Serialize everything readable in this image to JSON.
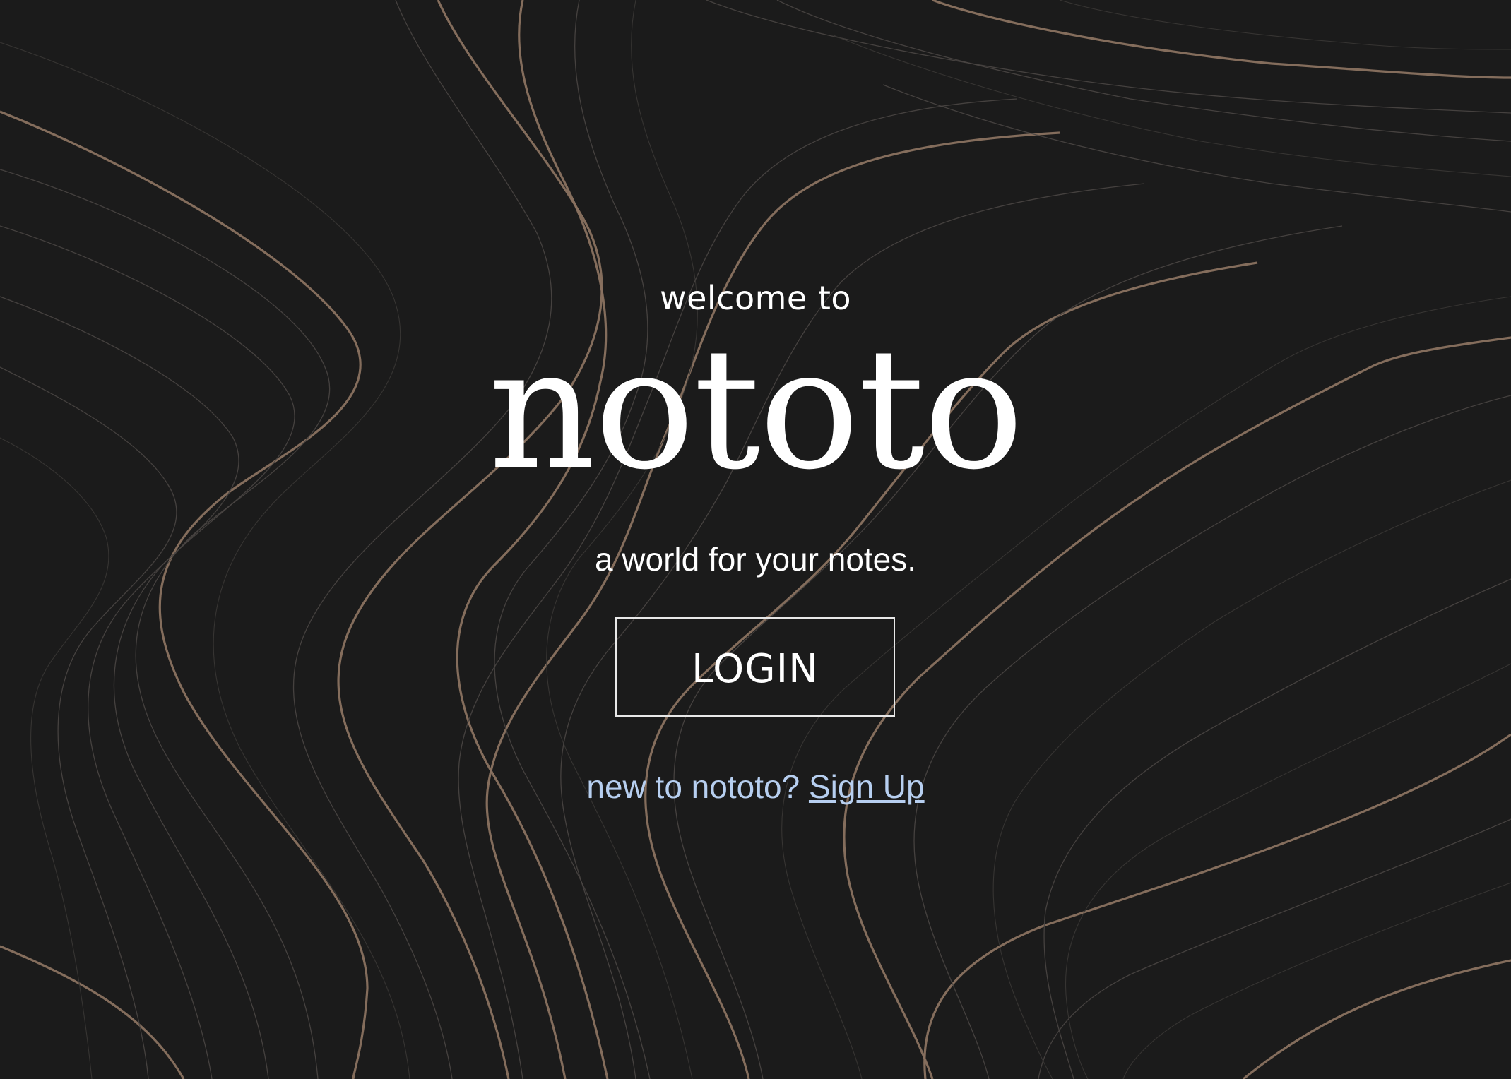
{
  "welcome_text": "welcome to",
  "brand_name": "nototo",
  "tagline": "a world for your notes.",
  "login_button": {
    "label": "LOGIN"
  },
  "signup": {
    "prompt": "new to nototo?",
    "link_label": "Sign Up"
  },
  "colors": {
    "background": "#1b1b1b",
    "text": "#ffffff",
    "link": "#b7cff0",
    "contour_accent": "#8a7260"
  },
  "background_pattern": "topographic-contour-lines"
}
